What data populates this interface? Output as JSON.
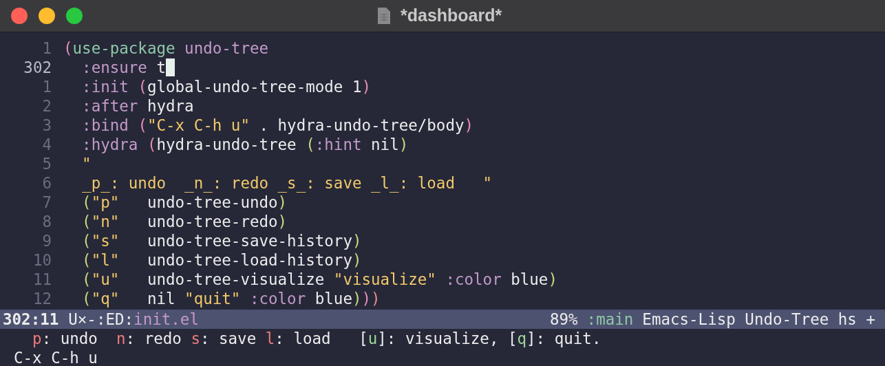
{
  "window": {
    "title": "*dashboard*"
  },
  "editor": {
    "lines": [
      {
        "number": "1",
        "current": false,
        "segments": [
          {
            "kind": "paren1",
            "text": "("
          },
          {
            "kind": "macro",
            "text": "use-package "
          },
          {
            "kind": "keyword",
            "text": "undo-tree"
          }
        ]
      },
      {
        "number": "302",
        "current": true,
        "segments": [
          {
            "kind": "keyword",
            "text": "  :ensure"
          },
          {
            "kind": "plain",
            "text": " t"
          }
        ]
      },
      {
        "number": "1",
        "current": false,
        "segments": [
          {
            "kind": "keyword",
            "text": "  :init "
          },
          {
            "kind": "paren1",
            "text": "("
          },
          {
            "kind": "plain",
            "text": "global-undo-tree-mode 1"
          },
          {
            "kind": "paren1",
            "text": ")"
          }
        ]
      },
      {
        "number": "2",
        "current": false,
        "segments": [
          {
            "kind": "keyword",
            "text": "  :after"
          },
          {
            "kind": "plain",
            "text": " hydra"
          }
        ]
      },
      {
        "number": "3",
        "current": false,
        "segments": [
          {
            "kind": "keyword",
            "text": "  :bind "
          },
          {
            "kind": "paren1",
            "text": "("
          },
          {
            "kind": "string",
            "text": "\"C-x C-h u\""
          },
          {
            "kind": "plain",
            "text": " . hydra-undo-tree/body"
          },
          {
            "kind": "paren1",
            "text": ")"
          }
        ]
      },
      {
        "number": "4",
        "current": false,
        "segments": [
          {
            "kind": "keyword",
            "text": "  :hydra "
          },
          {
            "kind": "paren1",
            "text": "("
          },
          {
            "kind": "plain",
            "text": "hydra-undo-tree "
          },
          {
            "kind": "paren2",
            "text": "("
          },
          {
            "kind": "keyword",
            "text": ":hint"
          },
          {
            "kind": "plain",
            "text": " nil"
          },
          {
            "kind": "paren2",
            "text": ")"
          }
        ]
      },
      {
        "number": "5",
        "current": false,
        "segments": [
          {
            "kind": "string",
            "text": "  \""
          }
        ]
      },
      {
        "number": "6",
        "current": false,
        "segments": [
          {
            "kind": "string",
            "text": "  _p_: undo  _n_: redo _s_: save _l_: load   \""
          }
        ]
      },
      {
        "number": "7",
        "current": false,
        "segments": [
          {
            "kind": "paren2",
            "text": "  ("
          },
          {
            "kind": "string",
            "text": "\"p\""
          },
          {
            "kind": "plain",
            "text": "   undo-tree-undo"
          },
          {
            "kind": "paren2",
            "text": ")"
          }
        ]
      },
      {
        "number": "8",
        "current": false,
        "segments": [
          {
            "kind": "paren2",
            "text": "  ("
          },
          {
            "kind": "string",
            "text": "\"n\""
          },
          {
            "kind": "plain",
            "text": "   undo-tree-redo"
          },
          {
            "kind": "paren2",
            "text": ")"
          }
        ]
      },
      {
        "number": "9",
        "current": false,
        "segments": [
          {
            "kind": "paren2",
            "text": "  ("
          },
          {
            "kind": "string",
            "text": "\"s\""
          },
          {
            "kind": "plain",
            "text": "   undo-tree-save-history"
          },
          {
            "kind": "paren2",
            "text": ")"
          }
        ]
      },
      {
        "number": "10",
        "current": false,
        "segments": [
          {
            "kind": "paren2",
            "text": "  ("
          },
          {
            "kind": "string",
            "text": "\"l\""
          },
          {
            "kind": "plain",
            "text": "   undo-tree-load-history"
          },
          {
            "kind": "paren2",
            "text": ")"
          }
        ]
      },
      {
        "number": "11",
        "current": false,
        "segments": [
          {
            "kind": "paren2",
            "text": "  ("
          },
          {
            "kind": "string",
            "text": "\"u\""
          },
          {
            "kind": "plain",
            "text": "   undo-tree-visualize "
          },
          {
            "kind": "string",
            "text": "\"visualize\""
          },
          {
            "kind": "keyword",
            "text": " :color"
          },
          {
            "kind": "plain",
            "text": " blue"
          },
          {
            "kind": "paren2",
            "text": ")"
          }
        ]
      },
      {
        "number": "12",
        "current": false,
        "segments": [
          {
            "kind": "paren2",
            "text": "  ("
          },
          {
            "kind": "string",
            "text": "\"q\""
          },
          {
            "kind": "plain",
            "text": "   nil "
          },
          {
            "kind": "string",
            "text": "\"quit\""
          },
          {
            "kind": "keyword",
            "text": " :color"
          },
          {
            "kind": "plain",
            "text": " blue"
          },
          {
            "kind": "paren2",
            "text": ")"
          },
          {
            "kind": "paren1",
            "text": ")"
          },
          {
            "kind": "paren3",
            "text": ")"
          }
        ]
      }
    ]
  },
  "mode_line": {
    "position": "302:11",
    "flags": "U×-:ED:",
    "buffer": "init.el",
    "percent": "89%",
    "branch": ":main",
    "modes": "Emacs-Lisp Undo-Tree hs +"
  },
  "minibuffer": {
    "lines": [
      [
        {
          "kind": "key",
          "text": "  p"
        },
        {
          "kind": "plain",
          "text": ": undo  "
        },
        {
          "kind": "key",
          "text": "n"
        },
        {
          "kind": "plain",
          "text": ": redo "
        },
        {
          "kind": "key",
          "text": "s"
        },
        {
          "kind": "plain",
          "text": ": save "
        },
        {
          "kind": "key",
          "text": "l"
        },
        {
          "kind": "plain",
          "text": ": load   ["
        },
        {
          "kind": "key2",
          "text": "u"
        },
        {
          "kind": "plain",
          "text": "]: visualize, ["
        },
        {
          "kind": "key2",
          "text": "q"
        },
        {
          "kind": "plain",
          "text": "]: quit."
        }
      ],
      [
        {
          "kind": "plain",
          "text": "C-x C-h u"
        }
      ]
    ]
  }
}
